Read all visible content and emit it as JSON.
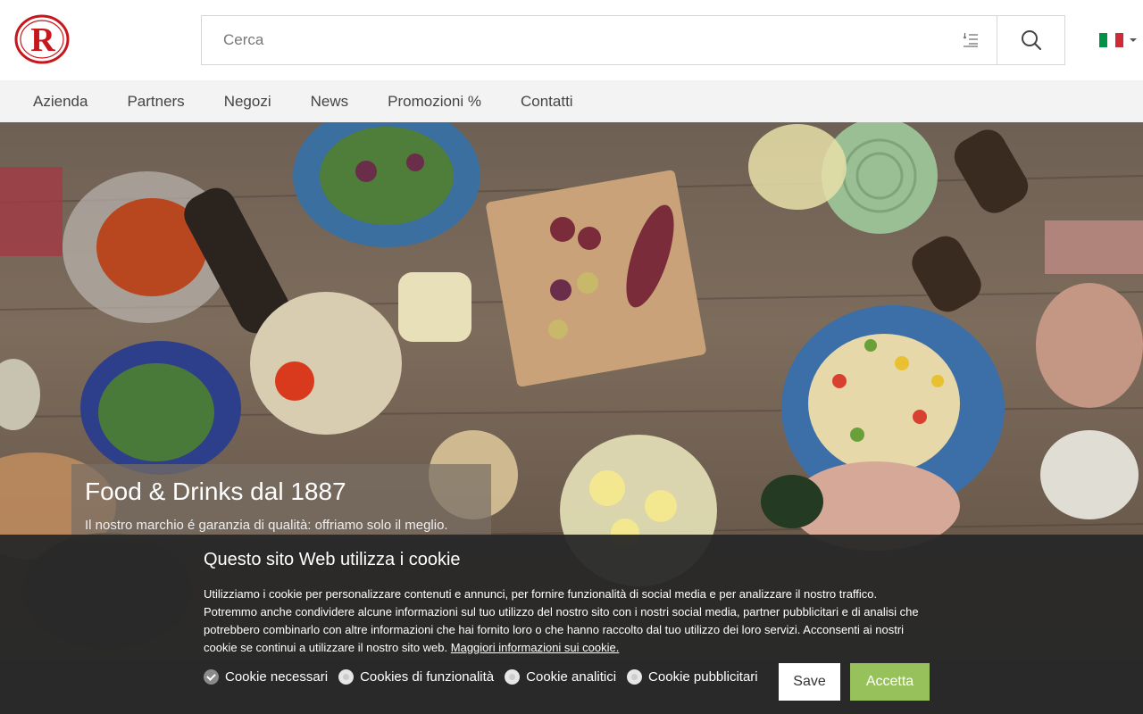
{
  "header": {
    "logo_icon": "brand-logo-r",
    "search": {
      "placeholder": "Cerca",
      "value": ""
    },
    "icons": {
      "filter": "list-filter-icon",
      "search": "search-icon"
    },
    "language": {
      "flag": "italy-flag",
      "colors": [
        "#009246",
        "#ffffff",
        "#ce2b37"
      ]
    }
  },
  "nav": {
    "items": [
      {
        "label": "Azienda"
      },
      {
        "label": "Partners"
      },
      {
        "label": "Negozi"
      },
      {
        "label": "News"
      },
      {
        "label": "Promozioni %"
      },
      {
        "label": "Contatti"
      }
    ]
  },
  "hero": {
    "title": "Food & Drinks dal 1887",
    "subtitle": "Il nostro marchio é garanzia di qualità: offriamo solo il meglio."
  },
  "cookie": {
    "title": "Questo sito Web utilizza i cookie",
    "text": "Utilizziamo i cookie per personalizzare contenuti e annunci, per fornire funzionalità di social media e per analizzare il nostro traffico. Potremmo anche condividere alcune informazioni sul tuo utilizzo del nostro sito con i nostri social media, partner pubblicitari e di analisi che potrebbero combinarlo con altre informazioni che hai fornito loro o che hanno raccolto dal tuo utilizzo dei loro servizi. Acconsenti ai nostri cookie se continui a utilizzare il nostro sito web.",
    "link": "Maggiori informazioni sui cookie.",
    "options": [
      {
        "label": "Cookie necessari",
        "checked": true
      },
      {
        "label": "Cookies di funzionalità",
        "checked": false
      },
      {
        "label": "Cookie analitici",
        "checked": false
      },
      {
        "label": "Cookie pubblicitari",
        "checked": false
      }
    ],
    "save_label": "Save",
    "accept_label": "Accetta",
    "accept_color": "#97c15a"
  },
  "brand_color": "#c8161d"
}
